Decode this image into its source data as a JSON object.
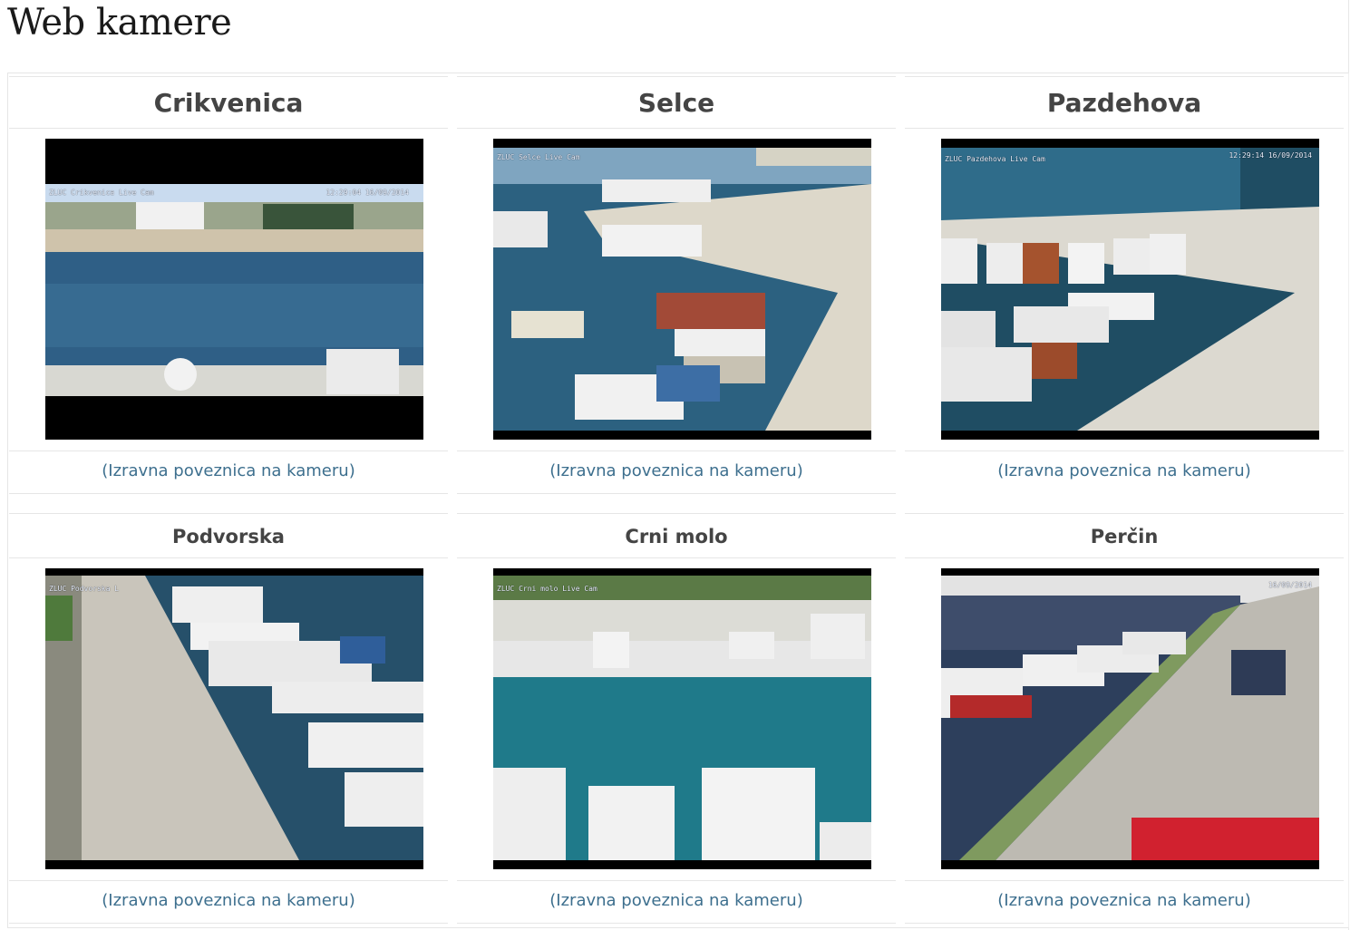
{
  "page": {
    "title": "Web kamere"
  },
  "cameras": [
    {
      "name": "Crikvenica",
      "link": "(Izravna poveznica na kameru)",
      "osd_left": "ZLUC Crikvenica Live Cam",
      "osd_right": "12:29:04 16/09/2014"
    },
    {
      "name": "Selce",
      "link": "(Izravna poveznica na kameru)",
      "osd_left": "ZLUC Selce Live Cam",
      "osd_right": ""
    },
    {
      "name": "Pazdehova",
      "link": "(Izravna poveznica na kameru)",
      "osd_left": "ZLUC Pazdehova Live Cam",
      "osd_right": "12:29:14 16/09/2014"
    },
    {
      "name": "Podvorska",
      "link": "(Izravna poveznica na kameru)",
      "osd_left": "ZLUC Podvorska L",
      "osd_right": ""
    },
    {
      "name": "Crni molo",
      "link": "(Izravna poveznica na kameru)",
      "osd_left": "ZLUC Crni molo Live Cam",
      "osd_right": ""
    },
    {
      "name": "Perčin",
      "link": "(Izravna poveznica na kameru)",
      "osd_left": "",
      "osd_right": "16/09/2014"
    }
  ],
  "colors": {
    "link": "#3d6f8e",
    "heading": "#444444",
    "border": "#e6e6e6"
  }
}
